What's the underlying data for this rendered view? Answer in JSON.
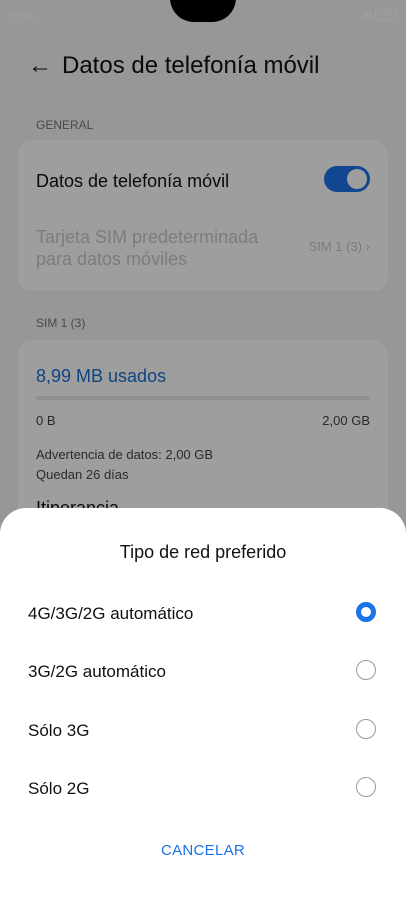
{
  "status_bar": {
    "time": "10:00",
    "battery": "100"
  },
  "header": {
    "back_icon": "arrow-left-icon",
    "title": "Datos de telefonía móvil"
  },
  "general": {
    "section_label": "GENERAL",
    "mobile_data_label": "Datos de telefonía móvil",
    "mobile_data_enabled": true,
    "default_sim_label_line1": "Tarjeta SIM predeterminada",
    "default_sim_label_line2": "para datos móviles",
    "default_sim_value": "SIM 1 (3)"
  },
  "sim1": {
    "section_label": "SIM 1 (3)",
    "usage": "8,99 MB usados",
    "range_start": "0 B",
    "range_end": "2,00 GB",
    "warning": "Advertencia de datos: 2,00 GB",
    "remaining": "Quedan 26 días",
    "partial_next": "Itinerancia"
  },
  "dialog": {
    "title": "Tipo de red preferido",
    "options": [
      {
        "label": "4G/3G/2G automático",
        "selected": true
      },
      {
        "label": "3G/2G automático",
        "selected": false
      },
      {
        "label": "Sólo 3G",
        "selected": false
      },
      {
        "label": "Sólo 2G",
        "selected": false
      }
    ],
    "cancel_label": "CANCELAR"
  },
  "colors": {
    "accent": "#1a73e8",
    "link": "#1a6fd0"
  }
}
